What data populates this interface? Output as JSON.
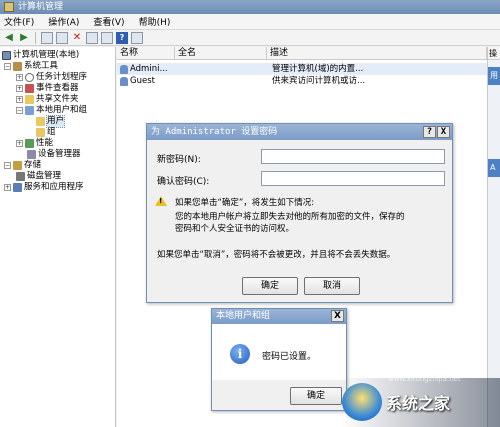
{
  "window": {
    "title": "计算机管理"
  },
  "menu": [
    "文件(F)",
    "操作(A)",
    "查看(V)",
    "帮助(H)"
  ],
  "tree": {
    "root": "计算机管理(本地)",
    "system_tools": "系统工具",
    "task_scheduler": "任务计划程序",
    "event_viewer": "事件查看器",
    "shared_folders": "共享文件夹",
    "local_users_groups": "本地用户和组",
    "users": "用户",
    "groups": "组",
    "performance": "性能",
    "device_manager": "设备管理器",
    "storage": "存储",
    "disk_management": "磁盘管理",
    "services_apps": "服务和应用程序"
  },
  "list": {
    "headers": [
      "名称",
      "全名",
      "描述"
    ],
    "rows": [
      {
        "name": "Admini...",
        "desc": "管理计算机(域)的内置..."
      },
      {
        "name": "Guest",
        "desc": "供来宾访问计算机或访..."
      }
    ]
  },
  "actions": {
    "header": "操",
    "item1": "用",
    "item2": "A"
  },
  "password_dialog": {
    "title": "为 Administrator 设置密码",
    "help_btn": "?",
    "close_btn": "X",
    "new_password_label": "新密码(N):",
    "confirm_password_label": "确认密码(C):",
    "line1": "如果您单击“确定”，将发生如下情况:",
    "line2": "您的本地用户帐户将立即失去对他的所有加密的文件，保存的",
    "line3": "密码和个人安全证书的访问权。",
    "line4": "如果您单击“取消”，密码将不会被更改，并且将不会丢失数据。",
    "ok": "确定",
    "cancel": "取消"
  },
  "message_box": {
    "title": "本地用户和组",
    "close_btn": "X",
    "text": "密码已设置。",
    "ok": "确定"
  },
  "watermark": {
    "text": "系统之家",
    "url": "www.xitongzhijia.net"
  }
}
